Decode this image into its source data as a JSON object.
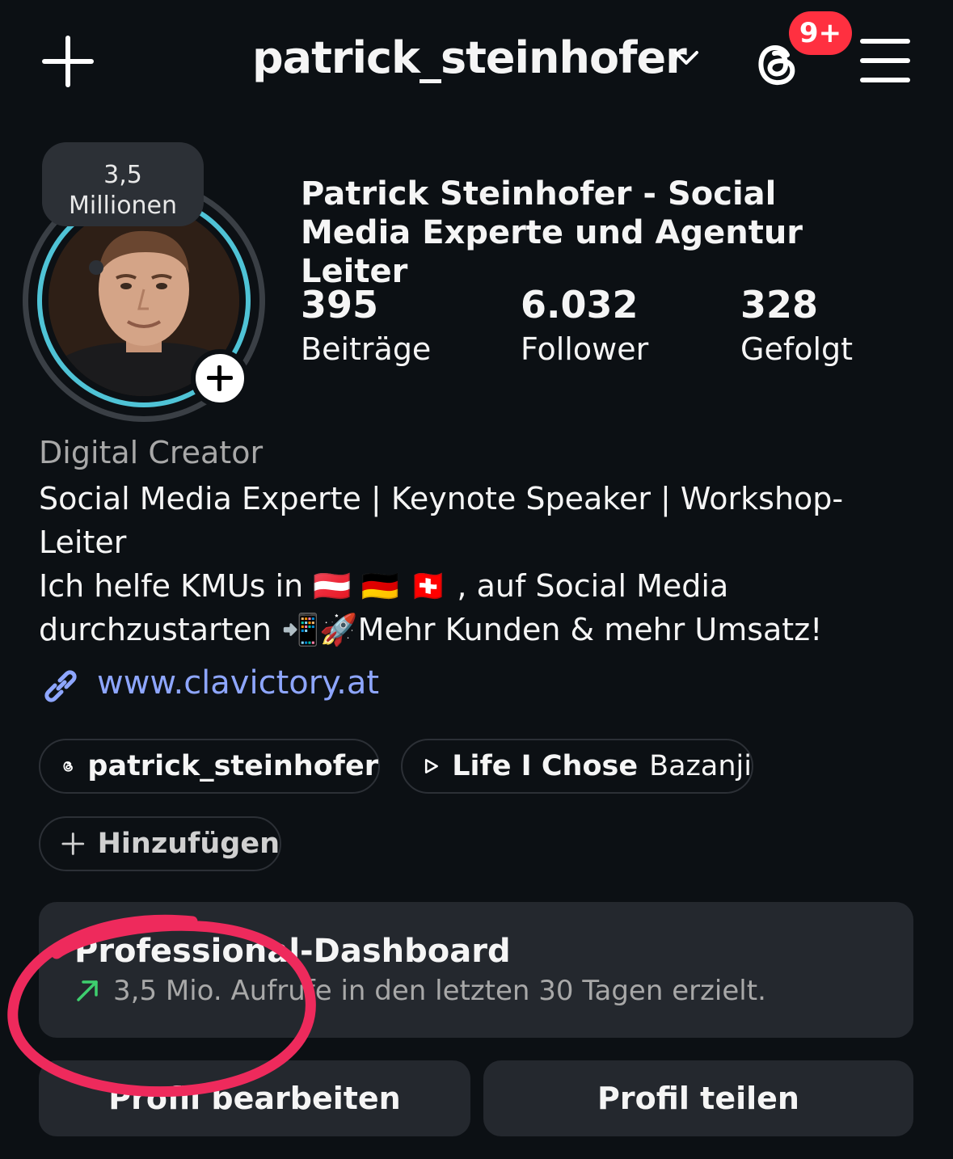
{
  "header": {
    "username": "patrick_steinhofer",
    "notification_badge": "9+",
    "icons": [
      "plus-icon",
      "chevron-down-icon",
      "threads-icon",
      "menu-icon"
    ]
  },
  "profile": {
    "note": "3,5\nMillionen",
    "full_name": "Patrick Steinhofer - Social Media Experte und Agentur Leiter",
    "stats": [
      {
        "value": "395",
        "label": "Beiträge"
      },
      {
        "value": "6.032",
        "label": "Follower"
      },
      {
        "value": "328",
        "label": "Gefolgt"
      }
    ],
    "category": "Digital Creator",
    "bio": "Social Media Experte | Keynote Speaker | Workshop-\nLeiter\nIch helfe KMUs in 🇦🇹 🇩🇪 🇨🇭 , auf Social Media\ndurchzustarten 📲🚀Mehr Kunden & mehr Umsatz!",
    "link": "www.clavictory.at"
  },
  "pills": {
    "threads": "patrick_steinhofer",
    "music_title": "Life I Chose",
    "music_artist": "Bazanji",
    "add": "Hinzufügen"
  },
  "dashboard": {
    "title": "Professional-Dashboard",
    "subtitle": "3,5 Mio. Aufrufe in den letzten 30 Tagen erzielt."
  },
  "buttons": {
    "edit": "Profil bearbeiten",
    "share": "Profil teilen"
  },
  "colors": {
    "background": "#0c1014",
    "badge": "#ff3040",
    "link": "#8ea6ff",
    "story_ring": "#4fc3d6",
    "trend_arrow": "#3ecf6e",
    "annotation": "#ee2a5c"
  }
}
